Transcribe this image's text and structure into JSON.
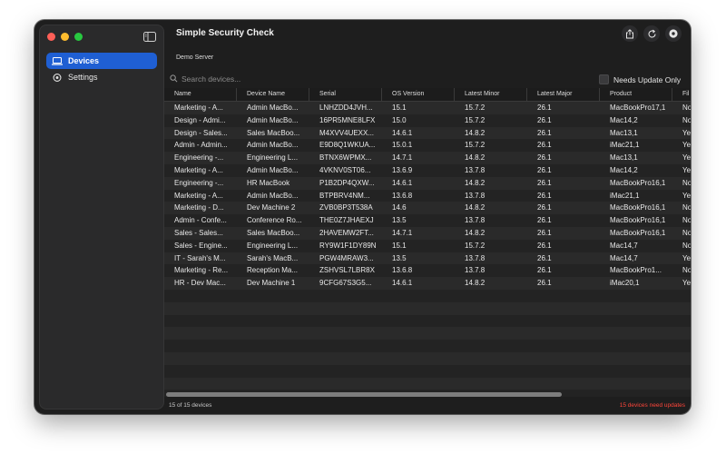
{
  "app": {
    "title": "Simple Security Check",
    "server": "Demo Server"
  },
  "sidebar": {
    "items": [
      {
        "label": "Devices",
        "icon": "laptop-icon",
        "active": true
      },
      {
        "label": "Settings",
        "icon": "gear-icon",
        "active": false
      }
    ]
  },
  "toolbar": {
    "buttons": [
      "share-icon",
      "refresh-icon",
      "settings-icon"
    ]
  },
  "search": {
    "placeholder": "Search devices...",
    "value": ""
  },
  "filter": {
    "needs_update_label": "Needs Update Only",
    "checked": false
  },
  "table": {
    "columns": [
      "Name",
      "Device Name",
      "Serial",
      "OS Version",
      "Latest Minor",
      "Latest Major",
      "Product",
      "Fil"
    ],
    "rows": [
      [
        "Marketing - A...",
        "Admin MacBo...",
        "LNHZDD4JVH...",
        "15.1",
        "15.7.2",
        "26.1",
        "MacBookPro17,1",
        "No"
      ],
      [
        "Design - Admi...",
        "Admin MacBo...",
        "16PR5MNE8LFX",
        "15.0",
        "15.7.2",
        "26.1",
        "Mac14,2",
        "No"
      ],
      [
        "Design - Sales...",
        "Sales MacBoo...",
        "M4XVV4UEXX...",
        "14.6.1",
        "14.8.2",
        "26.1",
        "Mac13,1",
        "Ye"
      ],
      [
        "Admin - Admin...",
        "Admin MacBo...",
        "E9D8Q1WKUA...",
        "15.0.1",
        "15.7.2",
        "26.1",
        "iMac21,1",
        "Ye"
      ],
      [
        "Engineering -...",
        "Engineering L...",
        "BTNX6WPMX...",
        "14.7.1",
        "14.8.2",
        "26.1",
        "Mac13,1",
        "Ye"
      ],
      [
        "Marketing - A...",
        "Admin MacBo...",
        "4VKNV0ST06...",
        "13.6.9",
        "13.7.8",
        "26.1",
        "Mac14,2",
        "Ye"
      ],
      [
        "Engineering -...",
        "HR MacBook",
        "P1B2DP4QXW...",
        "14.6.1",
        "14.8.2",
        "26.1",
        "MacBookPro16,1",
        "No"
      ],
      [
        "Marketing - A...",
        "Admin MacBo...",
        "BTPBRV4NM...",
        "13.6.8",
        "13.7.8",
        "26.1",
        "iMac21,1",
        "Ye"
      ],
      [
        "Marketing - D...",
        "Dev Machine 2",
        "ZVB0BP3T538A",
        "14.6",
        "14.8.2",
        "26.1",
        "MacBookPro16,1",
        "No"
      ],
      [
        "Admin - Confe...",
        "Conference Ro...",
        "THE0Z7JHAEXJ",
        "13.5",
        "13.7.8",
        "26.1",
        "MacBookPro16,1",
        "No"
      ],
      [
        "Sales - Sales...",
        "Sales MacBoo...",
        "2HAVEMW2FT...",
        "14.7.1",
        "14.8.2",
        "26.1",
        "MacBookPro16,1",
        "No"
      ],
      [
        "Sales - Engine...",
        "Engineering L...",
        "RY9W1F1DY89N",
        "15.1",
        "15.7.2",
        "26.1",
        "Mac14,7",
        "No"
      ],
      [
        "IT - Sarah's M...",
        "Sarah's MacB...",
        "PGW4MRAW3...",
        "13.5",
        "13.7.8",
        "26.1",
        "Mac14,7",
        "Ye"
      ],
      [
        "Marketing - Re...",
        "Reception Ma...",
        "ZSHVSL7LBR8X",
        "13.6.8",
        "13.7.8",
        "26.1",
        "MacBookPro1...",
        "No"
      ],
      [
        "HR - Dev Mac...",
        "Dev Machine 1",
        "9CFG67S3G5...",
        "14.6.1",
        "14.8.2",
        "26.1",
        "iMac20,1",
        "Ye"
      ]
    ]
  },
  "footer": {
    "count_text": "15 of 15 devices",
    "warning_text": "15 devices need updates",
    "warning_color": "#ff453a"
  },
  "colors": {
    "accent": "#1f5fd3"
  }
}
